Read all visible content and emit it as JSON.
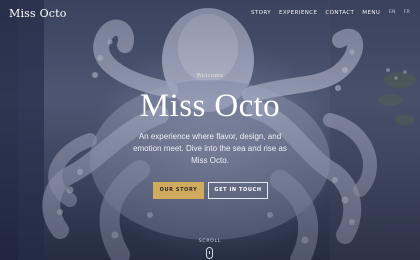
{
  "nav": {
    "logo": "Miss Octo",
    "menu": [
      "STORY",
      "EXPERIENCE",
      "CONTACT",
      "MENU"
    ],
    "languages": [
      "EN",
      "FR"
    ]
  },
  "hero": {
    "eyebrow": "Welcome",
    "title": "Miss Octo",
    "subtitle": "An experience where flavor, design, and emotion meet. Dive into the sea and rise as Miss Octo.",
    "primary_cta": "OUR STORY",
    "secondary_cta": "GET IN TOUCH",
    "scroll_label": "SCROLL"
  },
  "colors": {
    "accent": "#d1ab5d",
    "overlay": "#3a4560",
    "text": "#ffffff"
  }
}
